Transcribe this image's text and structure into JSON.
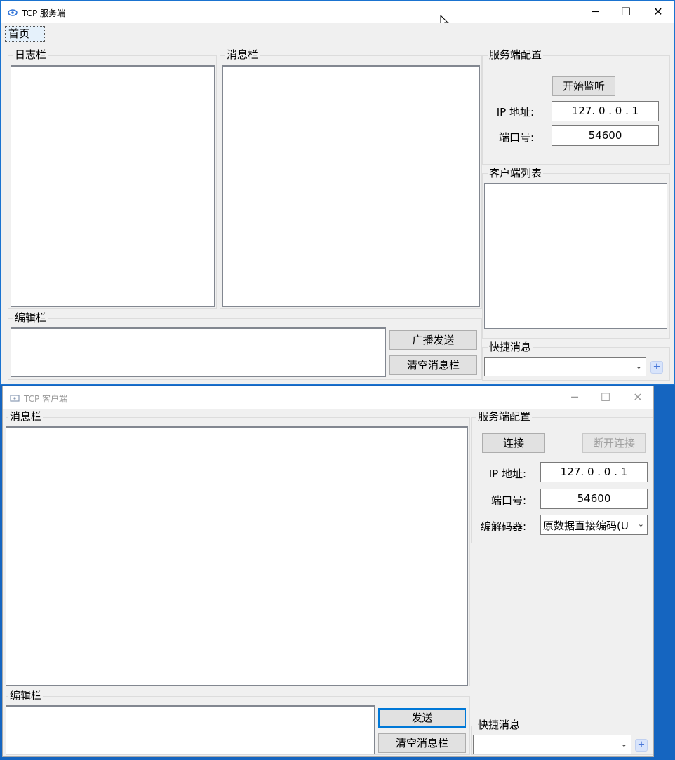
{
  "server": {
    "title": "TCP 服务端",
    "menu": [
      "首页"
    ],
    "log_group": "日志栏",
    "message_group": "消息栏",
    "edit_group": "编辑栏",
    "broadcast_button": "广播发送",
    "clear_button": "清空消息栏",
    "config_group": "服务端配置",
    "start_button": "开始监听",
    "ip_label": "IP 地址:",
    "ip_value": "127. 0 . 0 . 1",
    "port_label": "端口号:",
    "port_value": "54600",
    "client_list_group": "客户端列表",
    "quick_group": "快捷消息",
    "quick_value": ""
  },
  "client": {
    "title": "TCP 客户端",
    "message_group": "消息栏",
    "edit_group": "编辑栏",
    "send_button": "发送",
    "clear_button": "清空消息栏",
    "config_group": "服务端配置",
    "connect_button": "连接",
    "disconnect_button": "断开连接",
    "ip_label": "IP 地址:",
    "ip_value": "127. 0 . 0 . 1",
    "port_label": "端口号:",
    "port_value": "54600",
    "codec_label": "编解码器:",
    "codec_value": "原数据直接编码(U",
    "quick_group": "快捷消息",
    "quick_value": ""
  },
  "window_controls": {
    "minimize": "─",
    "maximize": "☐",
    "close": "✕"
  },
  "colors": {
    "accent": "#0078d7",
    "desktop": "#1565c0"
  }
}
